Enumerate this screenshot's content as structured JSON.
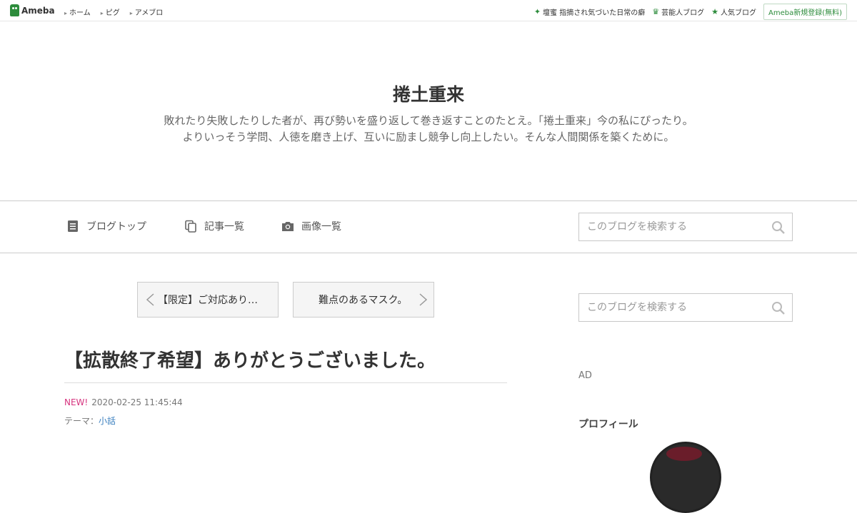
{
  "topbar": {
    "logo": "Ameba",
    "nav": [
      "ホーム",
      "ピグ",
      "アメブロ"
    ],
    "right": [
      {
        "icon": "sparkle-icon",
        "label": "壇蜜 指摘され気づいた日常の癖"
      },
      {
        "icon": "crown-icon",
        "label": "芸能人ブログ"
      },
      {
        "icon": "star-icon",
        "label": "人気ブログ"
      }
    ],
    "register": "Ameba新規登録(無料)"
  },
  "header": {
    "title": "捲土重来",
    "desc1": "敗れたり失敗したりした者が、再び勢いを盛り返して巻き返すことのたとえ。「捲土重来」今の私にぴったり。",
    "desc2": "よりいっそう学問、人徳を磨き上げ、互いに励まし競争し向上したい。そんな人間関係を築くために。"
  },
  "nav": {
    "top": "ブログトップ",
    "list": "記事一覧",
    "images": "画像一覧",
    "search_placeholder": "このブログを検索する"
  },
  "pager": {
    "prev": "【限定】ご対応あり…",
    "next": "難点のあるマスク。"
  },
  "article": {
    "title": "【拡散終了希望】ありがとうございました。",
    "new": "NEW!",
    "date": "2020-02-25 11:45:44",
    "theme_label": "テーマ：",
    "theme": "小話"
  },
  "sidebar": {
    "search_placeholder": "このブログを検索する",
    "ad": "AD",
    "profile": "プロフィール"
  },
  "colors": {
    "brand": "#2d8c3c",
    "new_badge": "#d6337e",
    "link": "#3a7fbf"
  }
}
